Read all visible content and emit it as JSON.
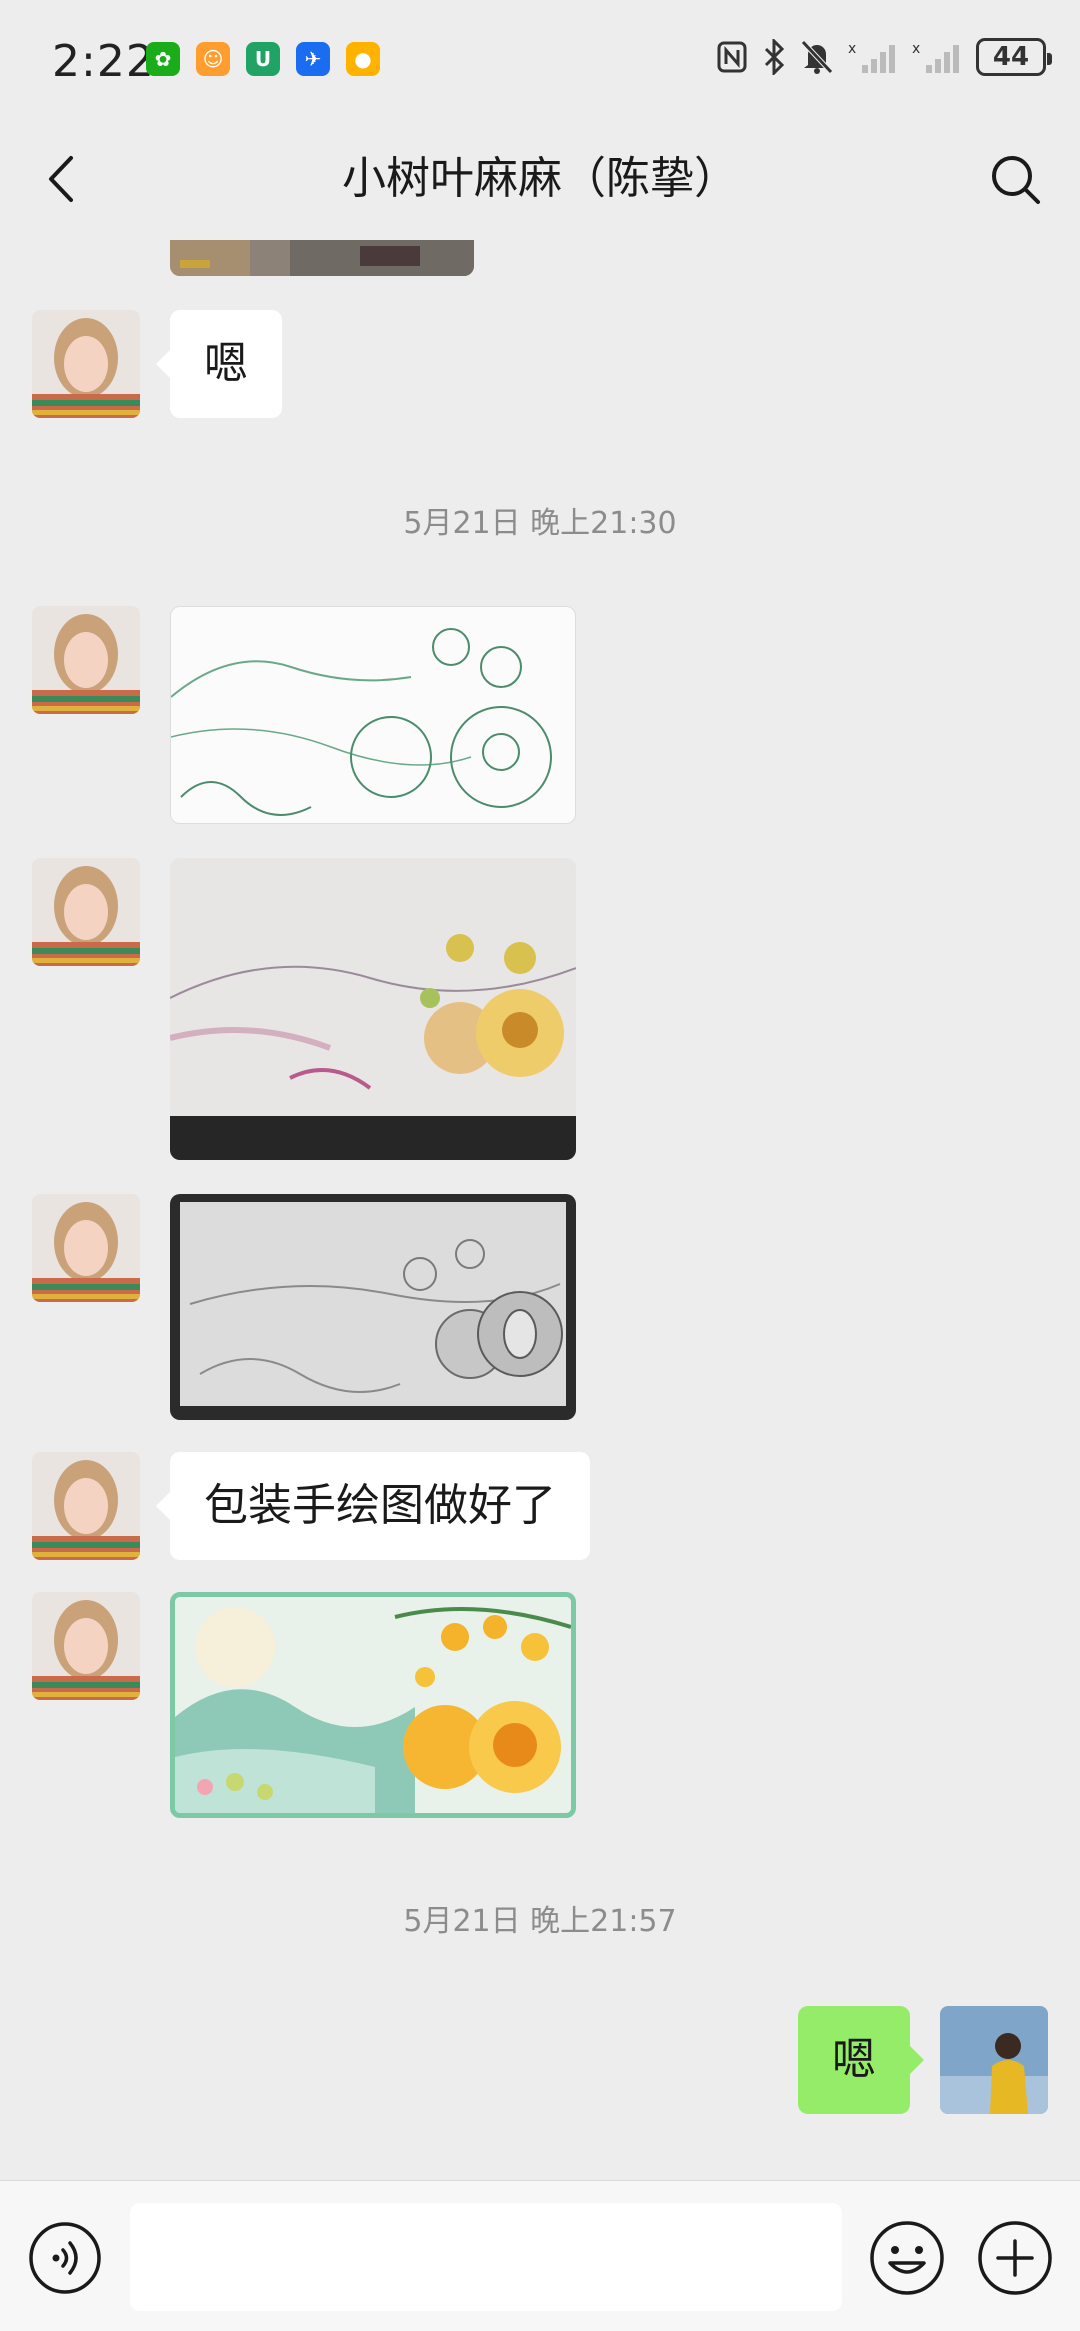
{
  "status_bar": {
    "time": "2:22",
    "battery": "44",
    "app_icons": [
      "leaf-app-icon",
      "courier-app-icon",
      "bag-app-icon",
      "flight-app-icon",
      "duck-app-icon"
    ]
  },
  "header": {
    "title": "小树叶麻麻（陈挚）"
  },
  "messages": {
    "msg_1": "嗯",
    "timestamp_1": "5月21日 晚上21:30",
    "msg_2": "包装手绘图做好了",
    "timestamp_2": "5月21日 晚上21:57",
    "msg_3": "嗯"
  },
  "colors": {
    "background": "#ededed",
    "sent_bubble": "#95ec69",
    "received_bubble": "#ffffff"
  },
  "icons": [
    "back-icon",
    "search-icon",
    "voice-icon",
    "emoji-icon",
    "plus-icon"
  ]
}
